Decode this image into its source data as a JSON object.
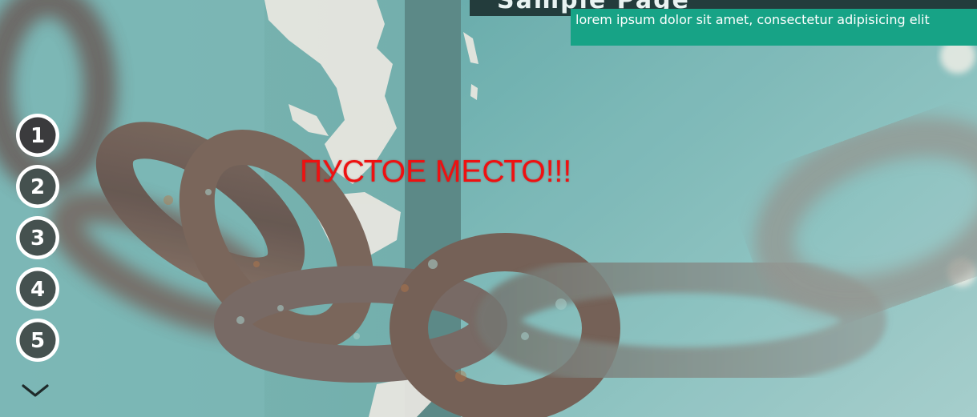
{
  "header": {
    "top_title": "Sample Page",
    "caption": "lorem ipsum dolor sit amet, consectetur adipisicing elit"
  },
  "content": {
    "placeholder_text": "ПУСТОЕ МЕСТО!!!"
  },
  "slider": {
    "items": [
      {
        "label": "1"
      },
      {
        "label": "2"
      },
      {
        "label": "3"
      },
      {
        "label": "4"
      },
      {
        "label": "5"
      }
    ],
    "next_icon": "chevron-down-icon"
  },
  "colors": {
    "caption_background": "#17a386",
    "placeholder_text": "#ee1111",
    "top_bar": "#233c3c"
  }
}
